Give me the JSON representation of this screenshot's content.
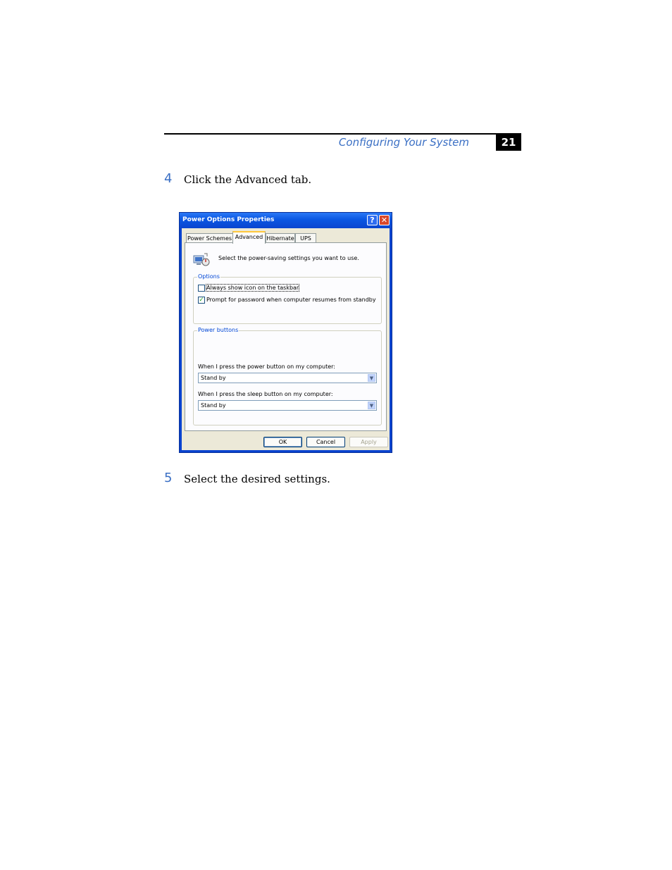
{
  "header": {
    "section_title": "Configuring Your System",
    "page_number": "21"
  },
  "steps": [
    {
      "number": "4",
      "text": "Click the Advanced tab."
    },
    {
      "number": "5",
      "text": "Select the desired settings."
    }
  ],
  "dialog": {
    "title": "Power Options Properties",
    "help_glyph": "?",
    "close_glyph": "✕",
    "tabs": [
      {
        "label": "Power Schemes",
        "active": false
      },
      {
        "label": "Advanced",
        "active": true
      },
      {
        "label": "Hibernate",
        "active": false
      },
      {
        "label": "UPS",
        "active": false
      }
    ],
    "icon": "power-options-icon",
    "intro": "Select the power-saving settings you want to use.",
    "options": {
      "label": "Options",
      "items": [
        {
          "label": "Always show icon on the taskbar",
          "checked": false
        },
        {
          "label": "Prompt for password when computer resumes from standby",
          "checked": true
        }
      ]
    },
    "power_buttons": {
      "label": "Power buttons",
      "power_button_label": "When I press the power button on my computer:",
      "power_button_value": "Stand by",
      "sleep_button_label": "When I press the sleep button on my computer:",
      "sleep_button_value": "Stand by"
    },
    "buttons": {
      "ok": "OK",
      "cancel": "Cancel",
      "apply": "Apply"
    },
    "colors": {
      "titlebar": "#0a56e2",
      "client": "#ece9d8",
      "group_label": "#0046d5",
      "accent_text": "#3a6fc4"
    }
  }
}
